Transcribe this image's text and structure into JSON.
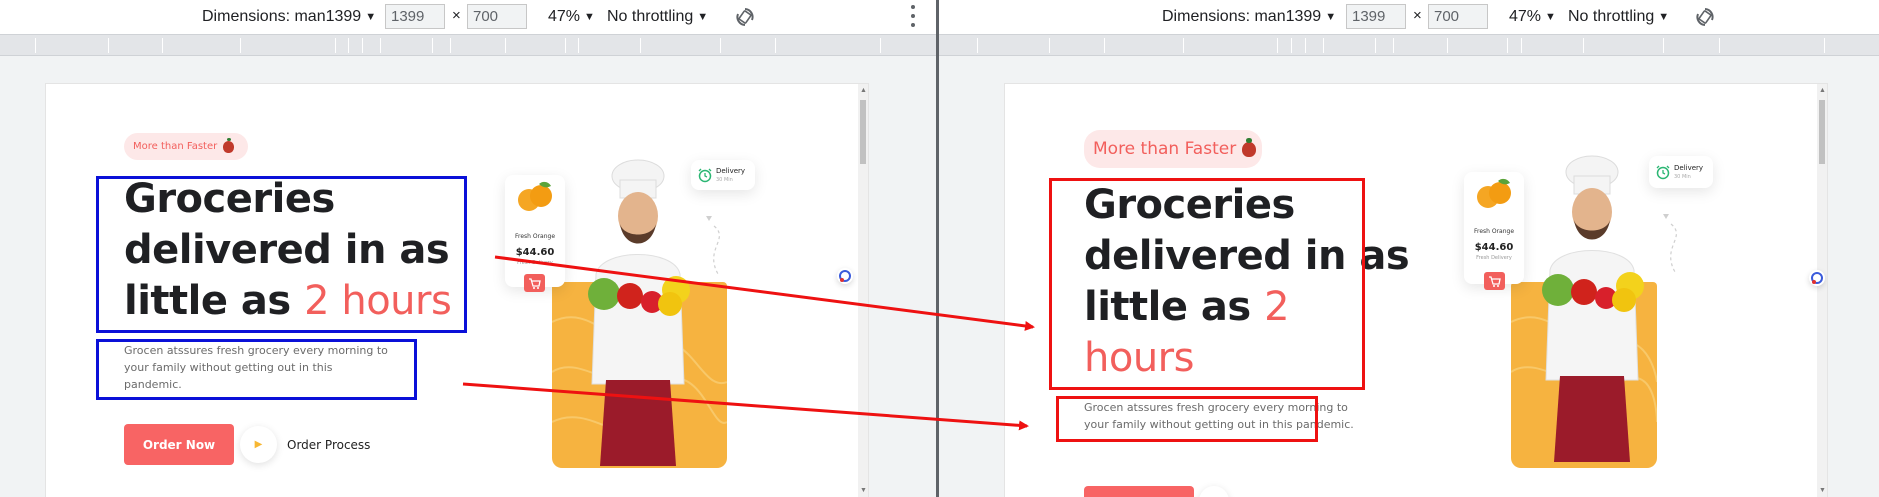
{
  "devtools": {
    "device_label": "Dimensions: man1399",
    "width_value": "1399",
    "height_value": "700",
    "times_symbol": "×",
    "zoom_label": "47%",
    "throttle_label": "No throttling",
    "rotate_icon": "rotate-icon",
    "more_icon": "kebab-menu-icon"
  },
  "page": {
    "badge_label": "More than Faster",
    "badge_icon": "strawberry-icon",
    "headline_line1": "Groceries",
    "headline_line2": "delivered in as",
    "headline_line3_prefix": "little as",
    "headline_accent_inline": "2 hours",
    "headline_accent_part1": "2",
    "headline_accent_part2": "hours",
    "description_left_line1": "Grocen atssures fresh grocery every morning to",
    "description_left_line2": "your family without getting out in this",
    "description_left_line3": "pandemic.",
    "description_right_line1": "Grocen atssures fresh grocery every morning to",
    "description_right_line2": "your family without getting out in this pandemic.",
    "order_button_label": "Order Now",
    "process_label": "Order Process",
    "product_card": {
      "name": "Fresh Orange",
      "price": "$44.60",
      "subtitle": "Fresh Delivery"
    },
    "delivery_card": {
      "title": "Delivery",
      "subtitle": "30 Min"
    }
  },
  "colors": {
    "accent": "#f25f5c",
    "button": "#f86464",
    "hero_block": "#f6b340",
    "badge_bg": "#fde8e8",
    "annotation_blue": "#0a10d8",
    "annotation_red": "#ee1111"
  }
}
